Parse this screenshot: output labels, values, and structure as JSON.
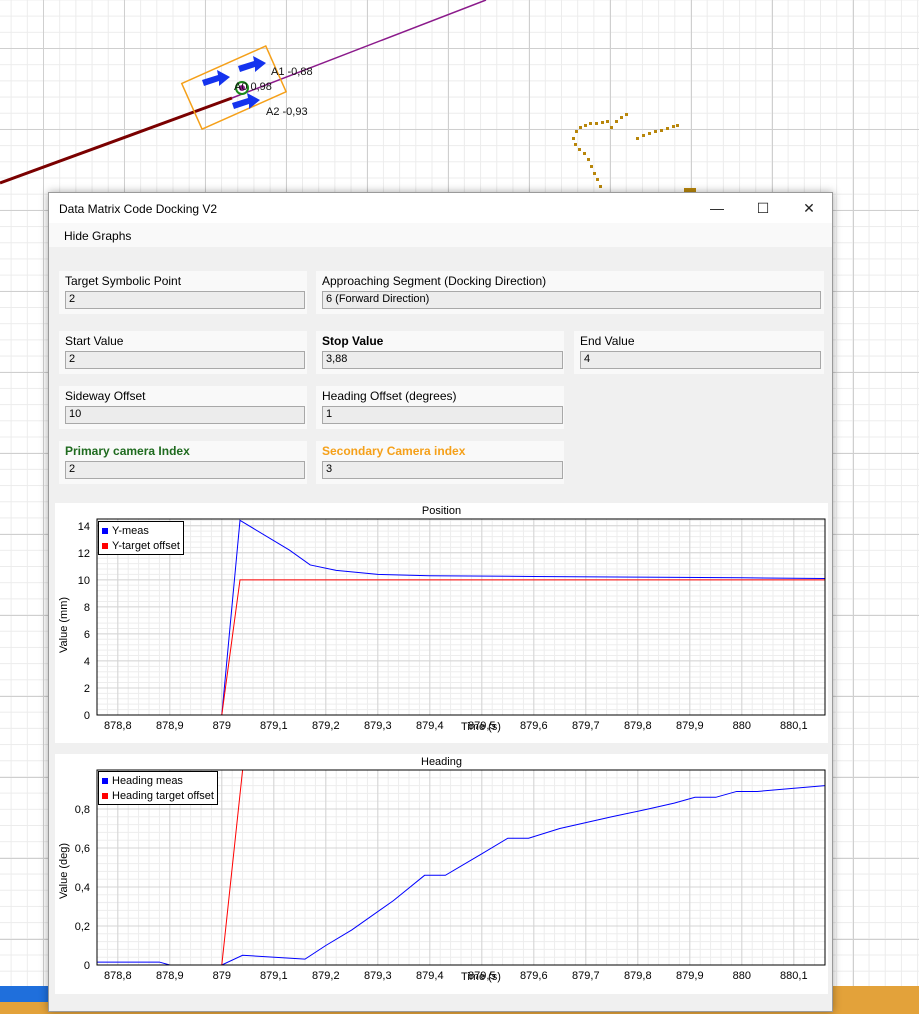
{
  "background": {
    "marker_labels": {
      "a1": "A1 -0,88",
      "a0": "A0 0,98",
      "a2": "A2 -0,93"
    }
  },
  "window": {
    "title": "Data Matrix Code Docking V2",
    "minimize_glyph": "—",
    "maximize_glyph": "☐",
    "close_glyph": "✕",
    "menu": {
      "hide_graphs": "Hide Graphs"
    }
  },
  "form": {
    "target_symbolic_point": {
      "label": "Target Symbolic Point",
      "value": "2"
    },
    "approaching_segment": {
      "label": "Approaching Segment (Docking Direction)",
      "value": "6 (Forward Direction)"
    },
    "start_value": {
      "label": "Start Value",
      "value": "2"
    },
    "stop_value": {
      "label": "Stop Value",
      "value": "3,88"
    },
    "end_value": {
      "label": "End Value",
      "value": "4"
    },
    "sideway_offset": {
      "label": "Sideway Offset",
      "value": "10"
    },
    "heading_offset": {
      "label": "Heading Offset (degrees)",
      "value": "1"
    },
    "primary_camera": {
      "label": "Primary camera Index",
      "value": "2",
      "color": "#1f6b1f"
    },
    "secondary_camera": {
      "label": "Secondary Camera index",
      "value": "3",
      "color": "#f5a019"
    }
  },
  "chart_data": [
    {
      "type": "line",
      "title": "Position",
      "ylabel": "Value (mm)",
      "xlabel": "Time (s)",
      "xlim": [
        878.76,
        880.16
      ],
      "ylim": [
        0,
        14.5
      ],
      "x_ticks": [
        "878,8",
        "878,9",
        "879",
        "879,1",
        "879,2",
        "879,3",
        "879,4",
        "879,5",
        "879,6",
        "879,7",
        "879,8",
        "879,9",
        "880",
        "880,1"
      ],
      "y_ticks": [
        "0",
        "2",
        "4",
        "6",
        "8",
        "10",
        "12",
        "14"
      ],
      "legend": "top-left",
      "grid": true,
      "series": [
        {
          "name": "Y-meas",
          "color": "#0000ff",
          "points": [
            [
              878.76,
              0
            ],
            [
              879.0,
              0
            ],
            [
              879.035,
              14.4
            ],
            [
              879.13,
              12.2
            ],
            [
              879.17,
              11.1
            ],
            [
              879.22,
              10.7
            ],
            [
              879.3,
              10.4
            ],
            [
              879.4,
              10.3
            ],
            [
              879.6,
              10.25
            ],
            [
              879.8,
              10.2
            ],
            [
              880.0,
              10.15
            ],
            [
              880.16,
              10.1
            ]
          ]
        },
        {
          "name": "Y-target offset",
          "color": "#ff0000",
          "points": [
            [
              878.76,
              0
            ],
            [
              879.0,
              0
            ],
            [
              879.035,
              10
            ],
            [
              880.16,
              10
            ]
          ]
        }
      ]
    },
    {
      "type": "line",
      "title": "Heading",
      "ylabel": "Value (deg)",
      "xlabel": "Time (s)",
      "xlim": [
        878.76,
        880.16
      ],
      "ylim": [
        0,
        1.0
      ],
      "x_ticks": [
        "878,8",
        "878,9",
        "879",
        "879,1",
        "879,2",
        "879,3",
        "879,4",
        "879,5",
        "879,6",
        "879,7",
        "879,8",
        "879,9",
        "880",
        "880,1"
      ],
      "y_ticks": [
        "0",
        "0,2",
        "0,4",
        "0,6",
        "0,8"
      ],
      "legend": "top-left",
      "grid": true,
      "series": [
        {
          "name": "Heading meas",
          "color": "#0000ff",
          "points": [
            [
              878.76,
              0.015
            ],
            [
              878.88,
              0.015
            ],
            [
              878.9,
              0.0
            ],
            [
              879.0,
              0.0
            ],
            [
              879.04,
              0.05
            ],
            [
              879.16,
              0.03
            ],
            [
              879.2,
              0.1
            ],
            [
              879.25,
              0.18
            ],
            [
              879.33,
              0.33
            ],
            [
              879.39,
              0.46
            ],
            [
              879.43,
              0.46
            ],
            [
              879.5,
              0.57
            ],
            [
              879.55,
              0.65
            ],
            [
              879.59,
              0.65
            ],
            [
              879.65,
              0.7
            ],
            [
              879.75,
              0.76
            ],
            [
              879.82,
              0.8
            ],
            [
              879.87,
              0.83
            ],
            [
              879.91,
              0.86
            ],
            [
              879.95,
              0.86
            ],
            [
              879.99,
              0.89
            ],
            [
              880.03,
              0.89
            ],
            [
              880.16,
              0.92
            ]
          ]
        },
        {
          "name": "Heading target offset",
          "color": "#ff0000",
          "points": [
            [
              878.76,
              0
            ],
            [
              879.0,
              0
            ],
            [
              879.04,
              1.0
            ],
            [
              880.16,
              1.0
            ]
          ]
        }
      ]
    }
  ]
}
